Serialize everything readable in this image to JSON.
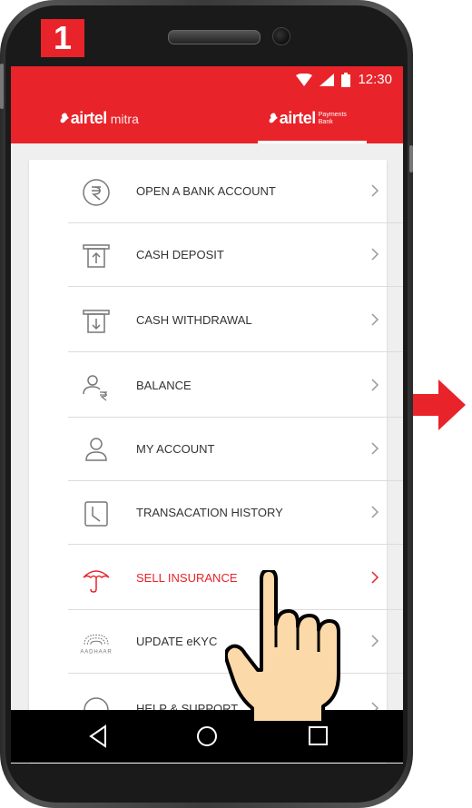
{
  "step_number": "1",
  "status_bar": {
    "time": "12:30"
  },
  "tabs": {
    "left": {
      "brand": "airtel",
      "suffix": "mitra"
    },
    "right": {
      "brand": "airtel",
      "sub_line1": "Payments",
      "sub_line2": "Bank"
    }
  },
  "menu": {
    "items": [
      {
        "label": "OPEN A BANK ACCOUNT",
        "icon": "rupee-circle-icon"
      },
      {
        "label": "CASH DEPOSIT",
        "icon": "atm-deposit-icon"
      },
      {
        "label": "CASH WITHDRAWAL",
        "icon": "atm-withdraw-icon"
      },
      {
        "label": "BALANCE",
        "icon": "user-rupee-icon"
      },
      {
        "label": "MY ACCOUNT",
        "icon": "user-icon"
      },
      {
        "label": "TRANSACATION HISTORY",
        "icon": "clock-doc-icon"
      },
      {
        "label": "SELL INSURANCE",
        "icon": "umbrella-icon",
        "active": true
      },
      {
        "label": "UPDATE eKYC",
        "icon": "aadhaar-icon"
      },
      {
        "label": "HELP & SUPPORT",
        "icon": "help-icon"
      }
    ],
    "aadhaar_text": "AADHAAR"
  },
  "colors": {
    "accent": "#e8232a",
    "text": "#333333",
    "divider": "#dcdcdc"
  },
  "nav": {
    "back": "back-icon",
    "home": "home-icon",
    "recents": "recents-icon"
  }
}
